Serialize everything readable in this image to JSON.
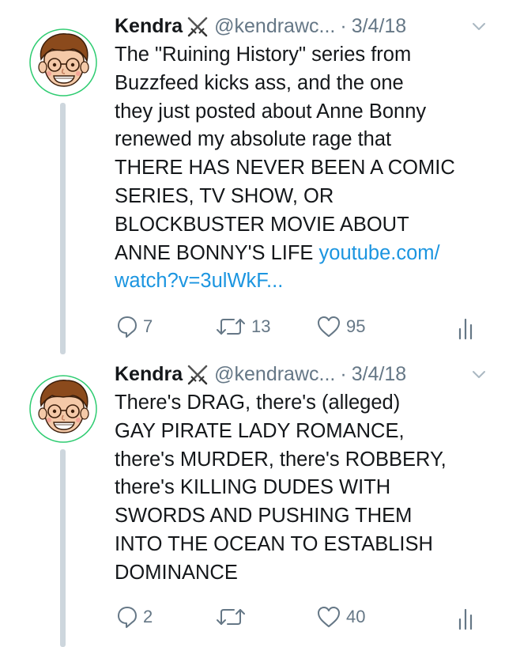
{
  "tweets": [
    {
      "name": "Kendra",
      "badge_icon": "crossed-swords-icon",
      "handle": "@kendrawc...",
      "separator": "·",
      "date": "3/4/18",
      "text_lines": [
        "The \"Ruining History\" series from",
        "Buzzfeed kicks ass, and the one",
        "they just posted about Anne Bonny",
        "renewed my absolute rage that",
        "THERE HAS NEVER BEEN A COMIC",
        "SERIES, TV SHOW, OR",
        "BLOCKBUSTER MOVIE ABOUT"
      ],
      "last_line_text": "ANNE BONNY'S LIFE",
      "link_part1": "youtube.com/",
      "link_part2": "watch?v=3ulWkF...",
      "replies": "7",
      "retweets": "13",
      "likes": "95"
    },
    {
      "name": "Kendra",
      "badge_icon": "crossed-swords-icon",
      "handle": "@kendrawc...",
      "separator": "·",
      "date": "3/4/18",
      "text_lines": [
        "There's DRAG, there's (alleged)",
        "GAY PIRATE LADY ROMANCE,",
        "there's MURDER, there's ROBBERY,",
        "there's KILLING DUDES WITH",
        "SWORDS AND PUSHING THEM",
        "INTO THE OCEAN TO ESTABLISH",
        "DOMINANCE"
      ],
      "replies": "2",
      "retweets": "",
      "likes": "40"
    }
  ],
  "colors": {
    "text": "#14171a",
    "muted": "#657786",
    "link": "#1b95e0",
    "thread_line": "#cdd6dd",
    "avatar_ring": "#2ecc71"
  }
}
